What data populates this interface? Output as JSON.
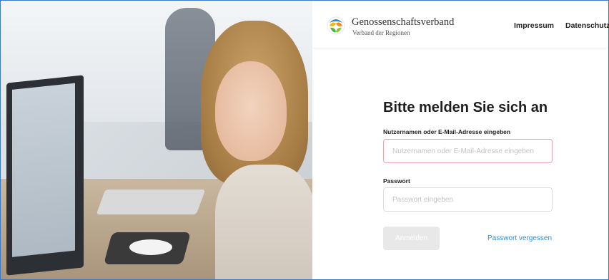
{
  "brand": {
    "name": "Genossenschaftsverband",
    "subtitle": "Verband der Regionen",
    "colors": {
      "frame": "#3b78c9",
      "link": "#2f8fd6",
      "invalid_border": "#e7a6b0"
    }
  },
  "nav": {
    "impressum": "Impressum",
    "datenschutz": "Datenschutz"
  },
  "login": {
    "title": "Bitte melden Sie sich an",
    "username_label": "Nutzernamen oder E-Mail-Adresse eingeben",
    "username_placeholder": "Nutzernamen oder E-Mail-Adresse eingeben",
    "username_value": "",
    "password_label": "Passwort",
    "password_placeholder": "Passwort eingeben",
    "password_value": "",
    "submit_label": "Anmelden",
    "forgot_label": "Passwort vergessen"
  }
}
